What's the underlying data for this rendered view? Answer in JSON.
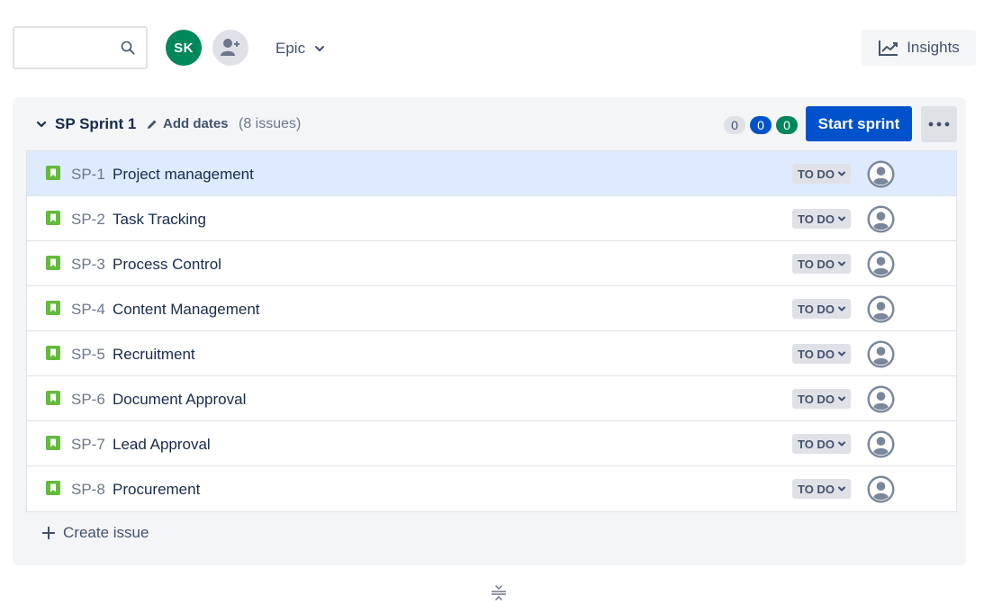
{
  "toolbar": {
    "search": {
      "value": "",
      "placeholder": ""
    },
    "avatar_initials": "SK",
    "avatar_color": "#00875a",
    "epic_label": "Epic",
    "insights_label": "Insights"
  },
  "sprint": {
    "name": "SP Sprint 1",
    "add_dates_label": "Add dates",
    "issue_count": "(8 issues)",
    "counts": {
      "todo": "0",
      "in_progress": "0",
      "done": "0"
    },
    "start_label": "Start sprint",
    "accent": "#0052cc",
    "issues": [
      {
        "key": "SP-1",
        "summary": "Project management",
        "status": "TO DO"
      },
      {
        "key": "SP-2",
        "summary": "Task Tracking",
        "status": "TO DO"
      },
      {
        "key": "SP-3",
        "summary": "Process Control",
        "status": "TO DO"
      },
      {
        "key": "SP-4",
        "summary": "Content Management",
        "status": "TO DO"
      },
      {
        "key": "SP-5",
        "summary": "Recruitment",
        "status": "TO DO"
      },
      {
        "key": "SP-6",
        "summary": "Document Approval",
        "status": "TO DO"
      },
      {
        "key": "SP-7",
        "summary": "Lead Approval",
        "status": "TO DO"
      },
      {
        "key": "SP-8",
        "summary": "Procurement",
        "status": "TO DO"
      }
    ],
    "create_issue_label": "Create issue"
  }
}
